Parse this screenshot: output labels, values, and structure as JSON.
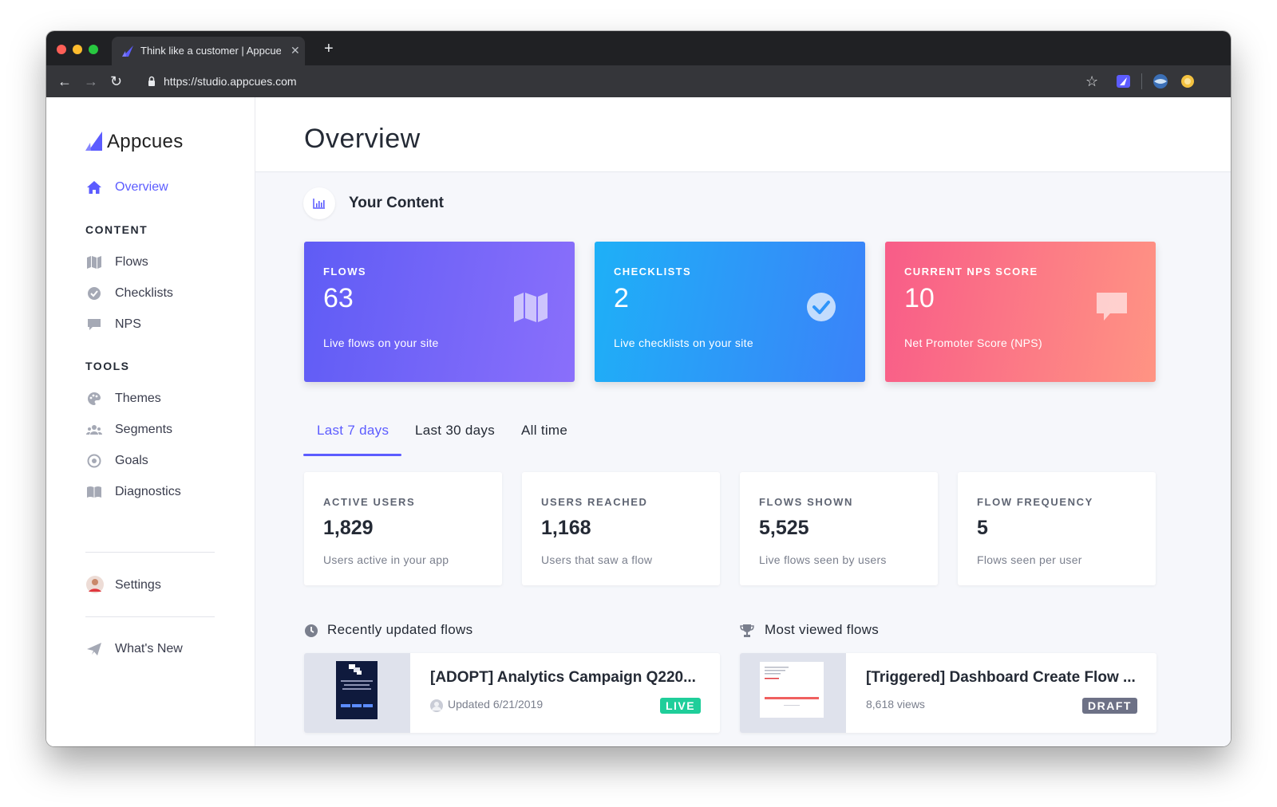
{
  "browser": {
    "tab_title": "Think like a customer | Appcues",
    "url": "https://studio.appcues.com",
    "new_tab_label": "+",
    "close_glyph": "✕",
    "back_glyph": "←",
    "forward_glyph": "→",
    "reload_glyph": "↻",
    "star_glyph": "☆"
  },
  "sidebar": {
    "brand": "Appcues",
    "overview_label": "Overview",
    "content_heading": "CONTENT",
    "content_items": [
      {
        "label": "Flows",
        "icon": "map-icon"
      },
      {
        "label": "Checklists",
        "icon": "check-circle-icon"
      },
      {
        "label": "NPS",
        "icon": "chat-icon"
      }
    ],
    "tools_heading": "TOOLS",
    "tools_items": [
      {
        "label": "Themes",
        "icon": "palette-icon"
      },
      {
        "label": "Segments",
        "icon": "users-icon"
      },
      {
        "label": "Goals",
        "icon": "target-icon"
      },
      {
        "label": "Diagnostics",
        "icon": "book-icon"
      }
    ],
    "settings_label": "Settings",
    "whats_new_label": "What's New"
  },
  "main": {
    "title": "Overview",
    "your_content": "Your Content",
    "cards": [
      {
        "label": "FLOWS",
        "value": "63",
        "desc": "Live flows on your site",
        "icon": "map-icon"
      },
      {
        "label": "CHECKLISTS",
        "value": "2",
        "desc": "Live checklists on your site",
        "icon": "check-circle-icon"
      },
      {
        "label": "CURRENT NPS SCORE",
        "value": "10",
        "desc": "Net Promoter Score (NPS)",
        "icon": "chat-icon"
      }
    ],
    "period_tabs": [
      "Last 7 days",
      "Last 30 days",
      "All time"
    ],
    "active_period": "Last 7 days",
    "stats": [
      {
        "label": "ACTIVE USERS",
        "value": "1,829",
        "desc": "Users active in your app"
      },
      {
        "label": "USERS REACHED",
        "value": "1,168",
        "desc": "Users that saw a flow"
      },
      {
        "label": "FLOWS SHOWN",
        "value": "5,525",
        "desc": "Live flows seen by users"
      },
      {
        "label": "FLOW FREQUENCY",
        "value": "5",
        "desc": "Flows seen per user"
      }
    ],
    "recent_title": "Recently updated flows",
    "most_viewed_title": "Most viewed flows",
    "recent_flow": {
      "name": "[ADOPT] Analytics Campaign Q220...",
      "meta": "Updated 6/21/2019",
      "badge": "LIVE"
    },
    "viewed_flow": {
      "name": "[Triggered] Dashboard Create Flow ...",
      "meta": "8,618 views",
      "badge": "DRAFT"
    }
  },
  "colors": {
    "accent": "#5c5cff",
    "flows_card": "#6a62f6",
    "checklists_card": "#2f95fa",
    "nps_card": "#f9707f",
    "live_badge": "#1fce9a",
    "draft_badge": "#6d7186"
  }
}
